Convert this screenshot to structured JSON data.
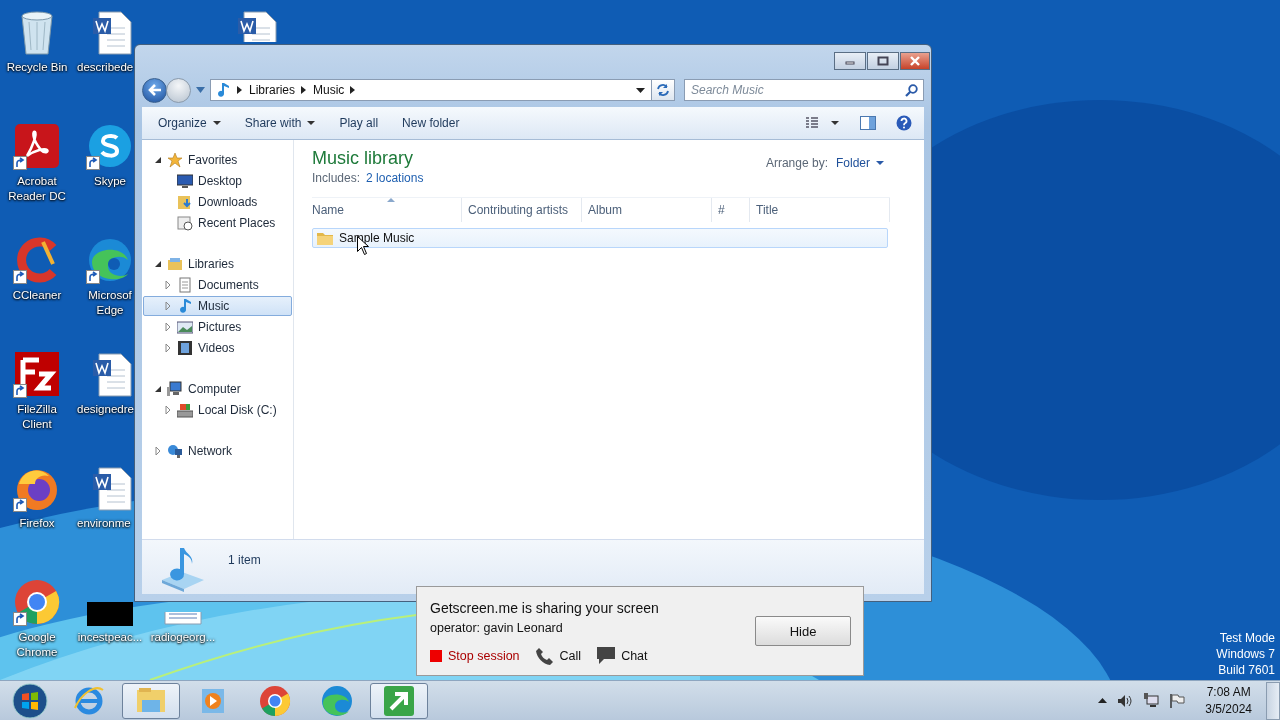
{
  "desktop": {
    "icons": [
      {
        "kind": "recycle",
        "label": "Recycle Bin"
      },
      {
        "kind": "pdf",
        "label": "Acrobat Reader DC"
      },
      {
        "kind": "ccleaner",
        "label": "CCleaner"
      },
      {
        "kind": "filezilla",
        "label": "FileZilla Client"
      },
      {
        "kind": "firefox",
        "label": "Firefox"
      },
      {
        "kind": "chrome",
        "label": "Google Chrome"
      },
      {
        "kind": "word",
        "label": "describede"
      },
      {
        "kind": "skype",
        "label": "Skype"
      },
      {
        "kind": "edge",
        "label": "Microsof Edge"
      },
      {
        "kind": "word",
        "label": "designedre"
      },
      {
        "kind": "word",
        "label": "environme"
      },
      {
        "kind": "black",
        "label": "incestpeac..."
      },
      {
        "kind": "doc",
        "label": "radiogeorg..."
      },
      {
        "kind": "word"
      }
    ]
  },
  "window": {
    "address": {
      "path": [
        "Libraries",
        "Music"
      ]
    },
    "search": {
      "placeholder": "Search Music"
    },
    "toolbar": [
      {
        "label": "Organize",
        "dropdown": true
      },
      {
        "label": "Share with",
        "dropdown": true
      },
      {
        "label": "Play all",
        "dropdown": false
      },
      {
        "label": "New folder",
        "dropdown": false
      }
    ],
    "nav_tree": [
      {
        "label": "Favorites",
        "kind": "star",
        "expanded": true,
        "selected": false,
        "children": [
          {
            "label": "Desktop",
            "kind": "desktop",
            "selected": false
          },
          {
            "label": "Downloads",
            "kind": "downloads",
            "selected": false
          },
          {
            "label": "Recent Places",
            "kind": "recent",
            "selected": false
          }
        ]
      },
      {
        "label": "Libraries",
        "kind": "libraries",
        "expanded": true,
        "selected": false,
        "children": [
          {
            "label": "Documents",
            "kind": "documents",
            "expanded": false,
            "selected": false
          },
          {
            "label": "Music",
            "kind": "music",
            "expanded": false,
            "selected": true
          },
          {
            "label": "Pictures",
            "kind": "pictures",
            "expanded": false,
            "selected": false
          },
          {
            "label": "Videos",
            "kind": "videos",
            "expanded": false,
            "selected": false
          }
        ]
      },
      {
        "label": "Computer",
        "kind": "computer",
        "expanded": true,
        "selected": false,
        "children": [
          {
            "label": "Local Disk (C:)",
            "kind": "disk",
            "expanded": false,
            "selected": false
          }
        ]
      },
      {
        "label": "Network",
        "kind": "network",
        "expanded": false,
        "selected": false
      }
    ],
    "library": {
      "title": "Music library",
      "includes_label": "Includes:",
      "includes_link": "2 locations",
      "arrange_label": "Arrange by:",
      "arrange_value": "Folder"
    },
    "columns": [
      {
        "label": "Name",
        "sorted": true
      },
      {
        "label": "Contributing artists",
        "sorted": false
      },
      {
        "label": "Album",
        "sorted": false
      },
      {
        "label": "#",
        "sorted": false
      },
      {
        "label": "Title",
        "sorted": false
      }
    ],
    "rows": [
      {
        "name": "Sample Music",
        "hovered": true
      }
    ],
    "status": "1 item"
  },
  "share_popup": {
    "title": "Getscreen.me is sharing your screen",
    "operator": "operator: gavin Leonard",
    "actions": [
      {
        "kind": "stop",
        "label": "Stop session"
      },
      {
        "kind": "call",
        "label": "Call"
      },
      {
        "kind": "chat",
        "label": "Chat"
      }
    ],
    "button": "Hide"
  },
  "os_notice": [
    "Test Mode",
    "Windows 7",
    "Build 7601"
  ],
  "taskbar": {
    "apps": [
      {
        "kind": "ie",
        "active": false
      },
      {
        "kind": "explorer",
        "active": true
      },
      {
        "kind": "media",
        "active": false
      },
      {
        "kind": "chrome",
        "active": false
      },
      {
        "kind": "edge",
        "active": false
      },
      {
        "kind": "arrow",
        "active": true
      }
    ],
    "time": "7:08 AM",
    "date": "3/5/2024"
  }
}
